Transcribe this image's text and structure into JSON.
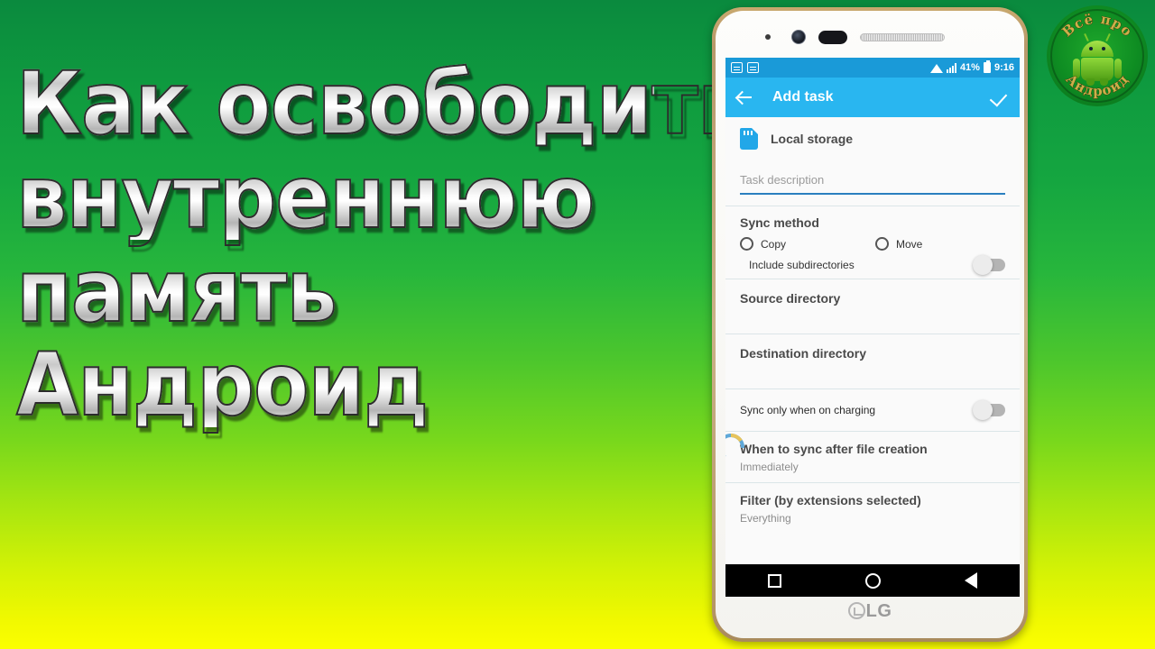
{
  "background": {
    "top_color": "#0a8a3e",
    "bottom_color": "#fbff00"
  },
  "title": {
    "line1": "Как освободить",
    "line2": "внутреннюю",
    "line3": "память",
    "line4": "Андроид"
  },
  "logo": {
    "name": "channel-logo",
    "text_top": "Всё про",
    "text_bottom": "Андроид",
    "icon": "android-robot-icon"
  },
  "phone": {
    "brand": "LG",
    "hardware": [
      "sensor-dot",
      "front-camera",
      "proximity-sensor",
      "earpiece-speaker"
    ]
  },
  "statusbar": {
    "icons_left": [
      "message-icon",
      "message-icon"
    ],
    "icons_right": [
      "wifi-icon",
      "signal-icon",
      "battery-icon"
    ],
    "battery_percent": "41%",
    "time": "9:16",
    "bg_color": "#1a9ad8"
  },
  "appbar": {
    "back_icon": "back-arrow-icon",
    "title": "Add task",
    "confirm_icon": "check-icon",
    "bg_color": "#29b6f0"
  },
  "form": {
    "storage": {
      "icon": "sd-card-icon",
      "label": "Local storage",
      "icon_color": "#22a7e8"
    },
    "description": {
      "placeholder": "Task description",
      "value": "",
      "underline_color": "#2a7fbf"
    },
    "sync_method": {
      "title": "Sync method",
      "options": [
        {
          "label": "Copy",
          "selected": false
        },
        {
          "label": "Move",
          "selected": false
        }
      ],
      "include_subdirectories": {
        "label": "Include subdirectories",
        "enabled": false
      }
    },
    "source_directory": {
      "label": "Source directory",
      "value": ""
    },
    "destination_directory": {
      "label": "Destination directory",
      "value": "",
      "spinner": "loading-spinner-icon"
    },
    "charging_only": {
      "label": "Sync only when on charging",
      "enabled": false
    },
    "when_to_sync": {
      "title": "When to sync after file creation",
      "value": "Immediately"
    },
    "filter": {
      "title": "Filter (by extensions selected)",
      "value": "Everything"
    }
  },
  "navbar": {
    "recents": "recents-square-icon",
    "home": "home-circle-icon",
    "back": "back-triangle-icon"
  }
}
